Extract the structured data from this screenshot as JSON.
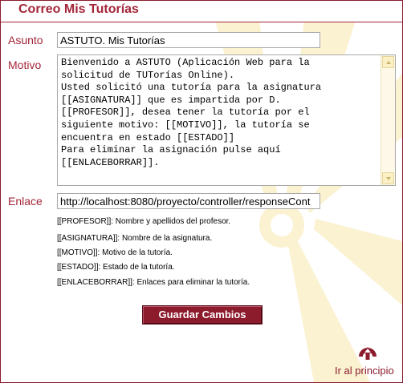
{
  "page": {
    "title": "Correo Mis Tutorías"
  },
  "form": {
    "asunto_label": "Asunto",
    "asunto_value": "ASTUTO. Mis Tutorías",
    "motivo_label": "Motivo",
    "motivo_value": "Bienvenido a ASTUTO (Aplicación Web para la\nsolicitud de TUTorías Online).\nUsted solicitó una tutoría para la asignatura\n[[ASIGNATURA]] que es impartida por D.\n[[PROFESOR]], desea tener la tutoría por el\nsiguiente motivo: [[MOTIVO]], la tutoría se\nencuentra en estado [[ESTADO]]\nPara eliminar la asignación pulse aquí\n[[ENLACEBORRAR]].",
    "enlace_label": "Enlace",
    "enlace_value": "http://localhost:8080/proyecto/controller/responseCont"
  },
  "help": [
    "[[PROFESOR]]: Nombre y apellidos del profesor.",
    "[[ASIGNATURA]]: Nombre de la asignatura.",
    "[[MOTIVO]]: Motivo de la tutoría.",
    "[[ESTADO]]: Estado de la tutoría.",
    "[[ENLACEBORRAR]]: Enlaces para eliminar la tutoría."
  ],
  "actions": {
    "save_label": "Guardar Cambios",
    "top_link_label": "Ir al principio"
  },
  "icons": {
    "top_link": "up-arrow-circle-icon"
  },
  "colors": {
    "brand": "#8c1b2c",
    "title": "#a3263a",
    "watermark": "#fbefc6",
    "scroll": "#fdf8e8"
  }
}
